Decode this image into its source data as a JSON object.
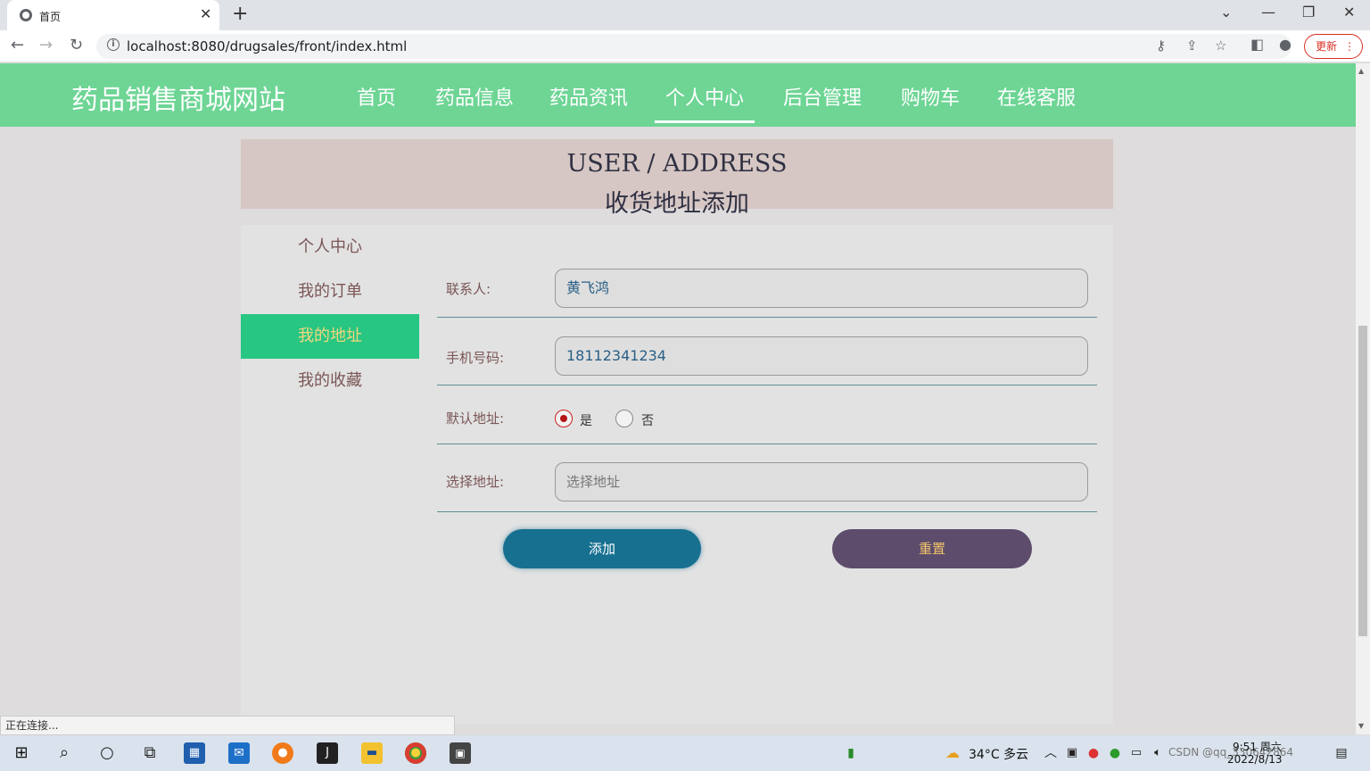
{
  "browser": {
    "tab_title": "首页",
    "url": "localhost:8080/drugsales/front/index.html",
    "update_label": "更新"
  },
  "site": {
    "logo": "药品销售商城网站",
    "nav": [
      {
        "label": "首页"
      },
      {
        "label": "药品信息"
      },
      {
        "label": "药品资讯"
      },
      {
        "label": "个人中心",
        "active": true
      },
      {
        "label": "后台管理"
      },
      {
        "label": "购物车"
      },
      {
        "label": "在线客服"
      }
    ]
  },
  "banner": {
    "english": "USER / ADDRESS",
    "chinese": "收货地址添加"
  },
  "sidebar": {
    "items": [
      {
        "label": "个人中心"
      },
      {
        "label": "我的订单"
      },
      {
        "label": "我的地址",
        "active": true
      },
      {
        "label": "我的收藏"
      }
    ]
  },
  "form": {
    "contact": {
      "label": "联系人:",
      "value": "黄飞鸿"
    },
    "phone": {
      "label": "手机号码:",
      "value": "18112341234"
    },
    "default_address": {
      "label": "默认地址:",
      "options": [
        {
          "label": "是",
          "checked": true
        },
        {
          "label": "否",
          "checked": false
        }
      ]
    },
    "address": {
      "label": "选择地址:",
      "placeholder": "选择地址"
    },
    "add_label": "添加",
    "reset_label": "重置"
  },
  "status_text": "正在连接...",
  "taskbar": {
    "weather": "34°C 多云",
    "time": "9:51 周六",
    "date": "2022/8/13",
    "watermark": "CSDN @qq_330642864"
  },
  "colors": {
    "header_bg": "#6ed595",
    "sidebar_active": "#27c682",
    "add_button": "#177090",
    "reset_button": "#5d4c6b"
  }
}
